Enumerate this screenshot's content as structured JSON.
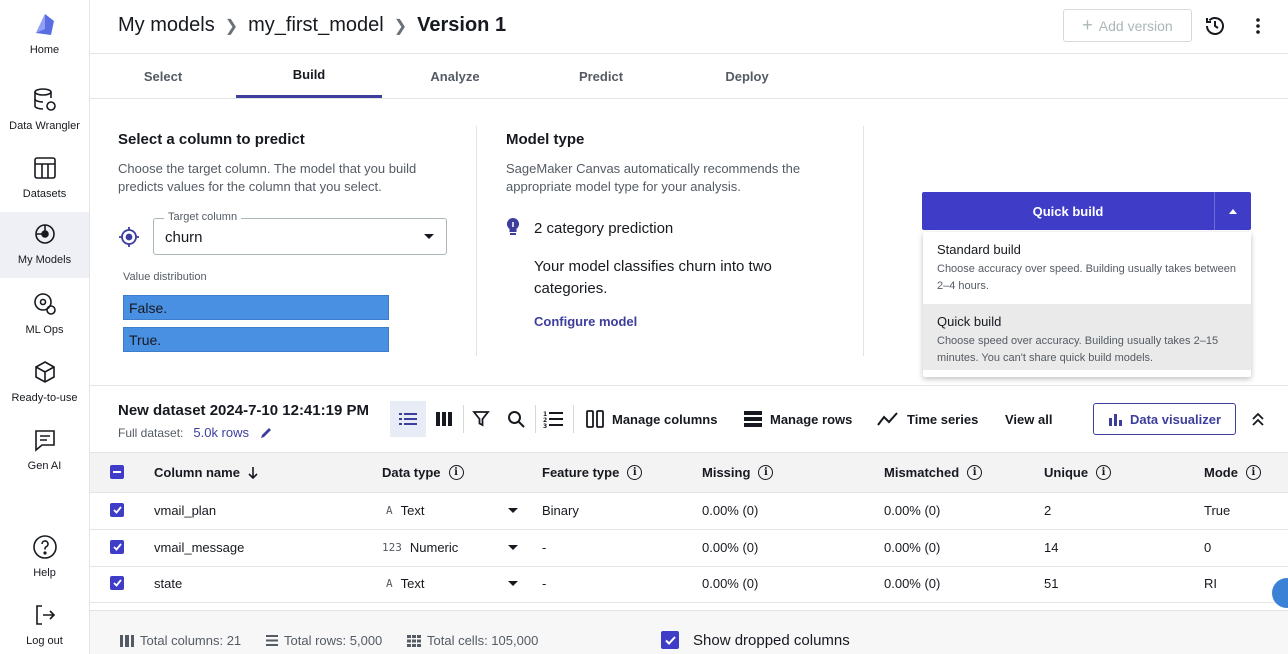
{
  "rail": {
    "items": [
      {
        "label": "Home",
        "icon": "canvas-logo-icon"
      },
      {
        "label": "Data Wrangler",
        "icon": "data-wrangler-icon"
      },
      {
        "label": "Datasets",
        "icon": "datasets-icon"
      },
      {
        "label": "My Models",
        "icon": "my-models-icon"
      },
      {
        "label": "ML Ops",
        "icon": "ml-ops-icon"
      },
      {
        "label": "Ready-to-use",
        "icon": "ready-to-use-icon"
      },
      {
        "label": "Gen AI",
        "icon": "gen-ai-icon"
      },
      {
        "label": "Help",
        "icon": "help-icon"
      },
      {
        "label": "Log out",
        "icon": "log-out-icon"
      }
    ]
  },
  "header": {
    "crumb1": "My models",
    "crumb2": "my_first_model",
    "crumb3": "Version 1",
    "add_version": "Add version"
  },
  "tabs": [
    "Select",
    "Build",
    "Analyze",
    "Predict",
    "Deploy"
  ],
  "active_tab": "Build",
  "predict": {
    "title": "Select a column to predict",
    "desc": "Choose the target column. The model that you build predicts values for the column that you select.",
    "target_label": "Target column",
    "target_value": "churn",
    "vd_label": "Value distribution",
    "bars": [
      "False.",
      "True."
    ]
  },
  "model_type": {
    "title": "Model type",
    "desc": "SageMaker Canvas automatically recommends the appropriate model type for your analysis.",
    "prediction": "2 category prediction",
    "prediction_desc": "Your model classifies churn into two categories.",
    "configure": "Configure model"
  },
  "build": {
    "button": "Quick build",
    "menu": [
      {
        "title": "Standard build",
        "desc": "Choose accuracy over speed. Building usually takes between 2–4 hours."
      },
      {
        "title": "Quick build",
        "desc": "Choose speed over accuracy. Building usually takes 2–15 minutes. You can't share quick build models."
      }
    ],
    "accent": "#3f3dc8"
  },
  "dataset": {
    "title": "New dataset 2024-7-10 12:41:19 PM",
    "full_label": "Full dataset:",
    "rows": "5.0k rows",
    "tools": {
      "manage_columns": "Manage columns",
      "manage_rows": "Manage rows",
      "time_series": "Time series",
      "view_all": "View all",
      "data_visualizer": "Data visualizer"
    }
  },
  "table": {
    "headers": {
      "column_name": "Column name",
      "data_type": "Data type",
      "feature_type": "Feature type",
      "missing": "Missing",
      "mismatched": "Mismatched",
      "unique": "Unique",
      "mode": "Mode"
    },
    "rows": [
      {
        "name": "vmail_plan",
        "type_icon": "A",
        "type": "Text",
        "feature": "Binary",
        "missing": "0.00% (0)",
        "mismatched": "0.00% (0)",
        "unique": "2",
        "mode": "True"
      },
      {
        "name": "vmail_message",
        "type_icon": "123",
        "type": "Numeric",
        "feature": "-",
        "missing": "0.00% (0)",
        "mismatched": "0.00% (0)",
        "unique": "14",
        "mode": "0"
      },
      {
        "name": "state",
        "type_icon": "A",
        "type": "Text",
        "feature": "-",
        "missing": "0.00% (0)",
        "mismatched": "0.00% (0)",
        "unique": "51",
        "mode": "RI"
      }
    ]
  },
  "footer": {
    "total_columns": "Total columns: 21",
    "total_rows": "Total rows: 5,000",
    "total_cells": "Total cells: 105,000",
    "show_dropped": "Show dropped columns"
  }
}
